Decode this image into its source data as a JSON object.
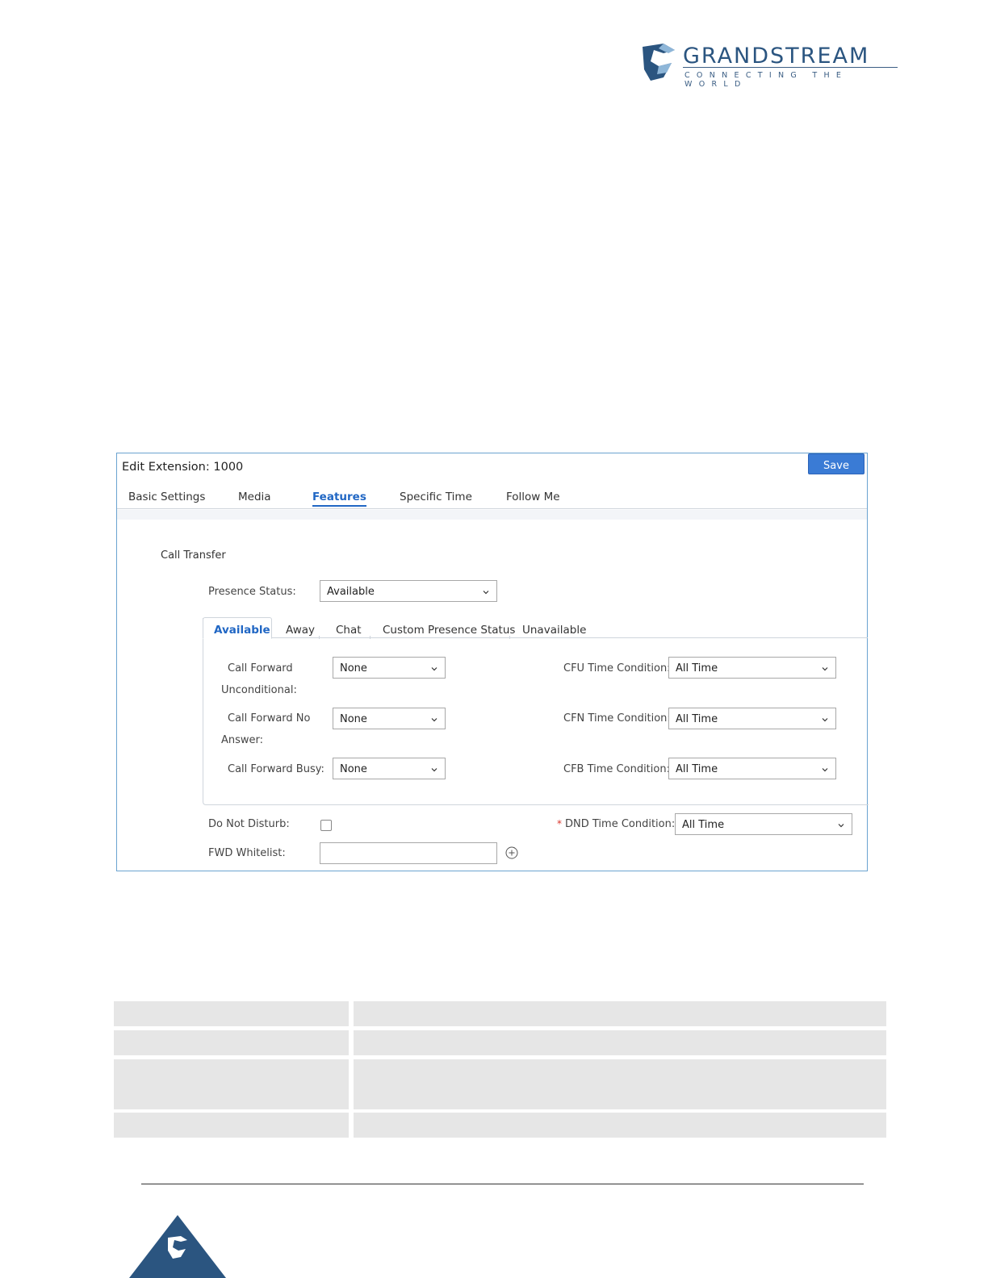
{
  "brand": {
    "name": "GRANDSTREAM",
    "tagline": "CONNECTING THE WORLD",
    "color": "#2b5580"
  },
  "dialog": {
    "title": "Edit Extension: 1000",
    "save_label": "Save",
    "tabs": [
      {
        "label": "Basic Settings",
        "active": false
      },
      {
        "label": "Media",
        "active": false
      },
      {
        "label": "Features",
        "active": true
      },
      {
        "label": "Specific Time",
        "active": false
      },
      {
        "label": "Follow Me",
        "active": false
      }
    ],
    "section_title": "Call Transfer",
    "presence": {
      "label": "Presence Status:",
      "value": "Available"
    },
    "subtabs": [
      {
        "label": "Available",
        "active": true
      },
      {
        "label": "Away",
        "active": false
      },
      {
        "label": "Chat",
        "active": false
      },
      {
        "label": "Custom Presence Status",
        "active": false
      },
      {
        "label": "Unavailable",
        "active": false
      }
    ],
    "cfu": {
      "label_line1": "Call Forward",
      "label_line2": "Unconditional:",
      "value": "None",
      "time_label": "CFU Time Condition:",
      "time_value": "All Time"
    },
    "cfn": {
      "label_line1": "Call Forward No",
      "label_line2": "Answer:",
      "value": "None",
      "time_label": "CFN Time Condition:",
      "time_value": "All Time"
    },
    "cfb": {
      "label": "Call Forward Busy:",
      "value": "None",
      "time_label": "CFB Time Condition:",
      "time_value": "All Time"
    },
    "dnd": {
      "label": "Do Not Disturb:",
      "checked": false,
      "required_mark": "*",
      "time_label": "DND Time Condition:",
      "time_value": "All Time"
    },
    "fwd_whitelist": {
      "label": "FWD Whitelist:",
      "value": ""
    }
  },
  "colors": {
    "accent": "#2167c4",
    "save_button": "#3a7bd5",
    "dialog_border": "#6ba3d0",
    "table_cell": "#e6e6e6"
  }
}
